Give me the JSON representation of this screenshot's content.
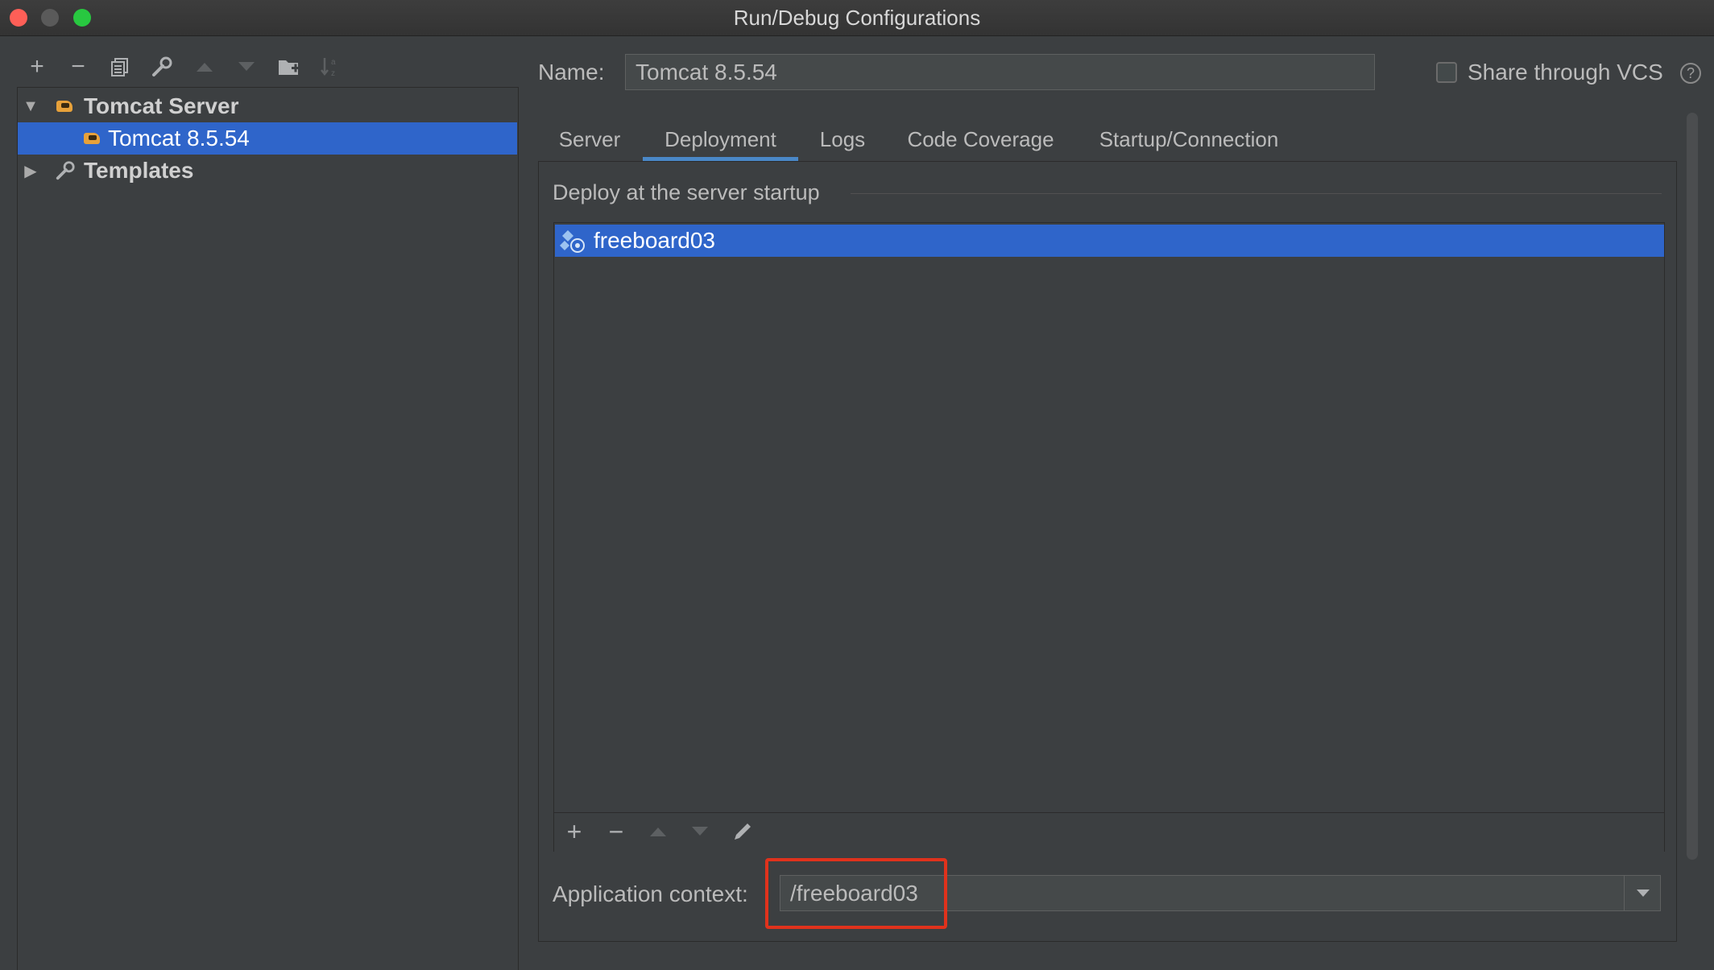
{
  "window": {
    "title": "Run/Debug Configurations"
  },
  "left": {
    "tree": [
      {
        "label": "Tomcat Server",
        "expanded": true,
        "icon": "tomcat-icon"
      },
      {
        "label": "Tomcat 8.5.54",
        "selected": true,
        "icon": "tomcat-icon"
      },
      {
        "label": "Templates",
        "expanded": false,
        "icon": "wrench-icon"
      }
    ],
    "toolbar": [
      "add-icon",
      "remove-icon",
      "copy-icon",
      "wrench-icon",
      "move-up-icon",
      "move-down-icon",
      "new-folder-icon",
      "sort-icon"
    ]
  },
  "config": {
    "name_label": "Name:",
    "name_value": "Tomcat 8.5.54",
    "share_label": "Share through VCS",
    "share_checked": false
  },
  "tabs": [
    {
      "label": "Server",
      "active": false
    },
    {
      "label": "Deployment",
      "active": true
    },
    {
      "label": "Logs",
      "active": false
    },
    {
      "label": "Code Coverage",
      "active": false
    },
    {
      "label": "Startup/Connection",
      "active": false
    }
  ],
  "deployment": {
    "section_title": "Deploy at the server startup",
    "artifacts": [
      {
        "label": "freeboard03",
        "selected": true,
        "icon": "artifact-icon"
      }
    ],
    "context_label": "Application context:",
    "context_value": "/freeboard03"
  },
  "colors": {
    "selection": "#2f65ca",
    "highlight_box": "#e0321c",
    "tab_underline": "#4a88c7"
  }
}
